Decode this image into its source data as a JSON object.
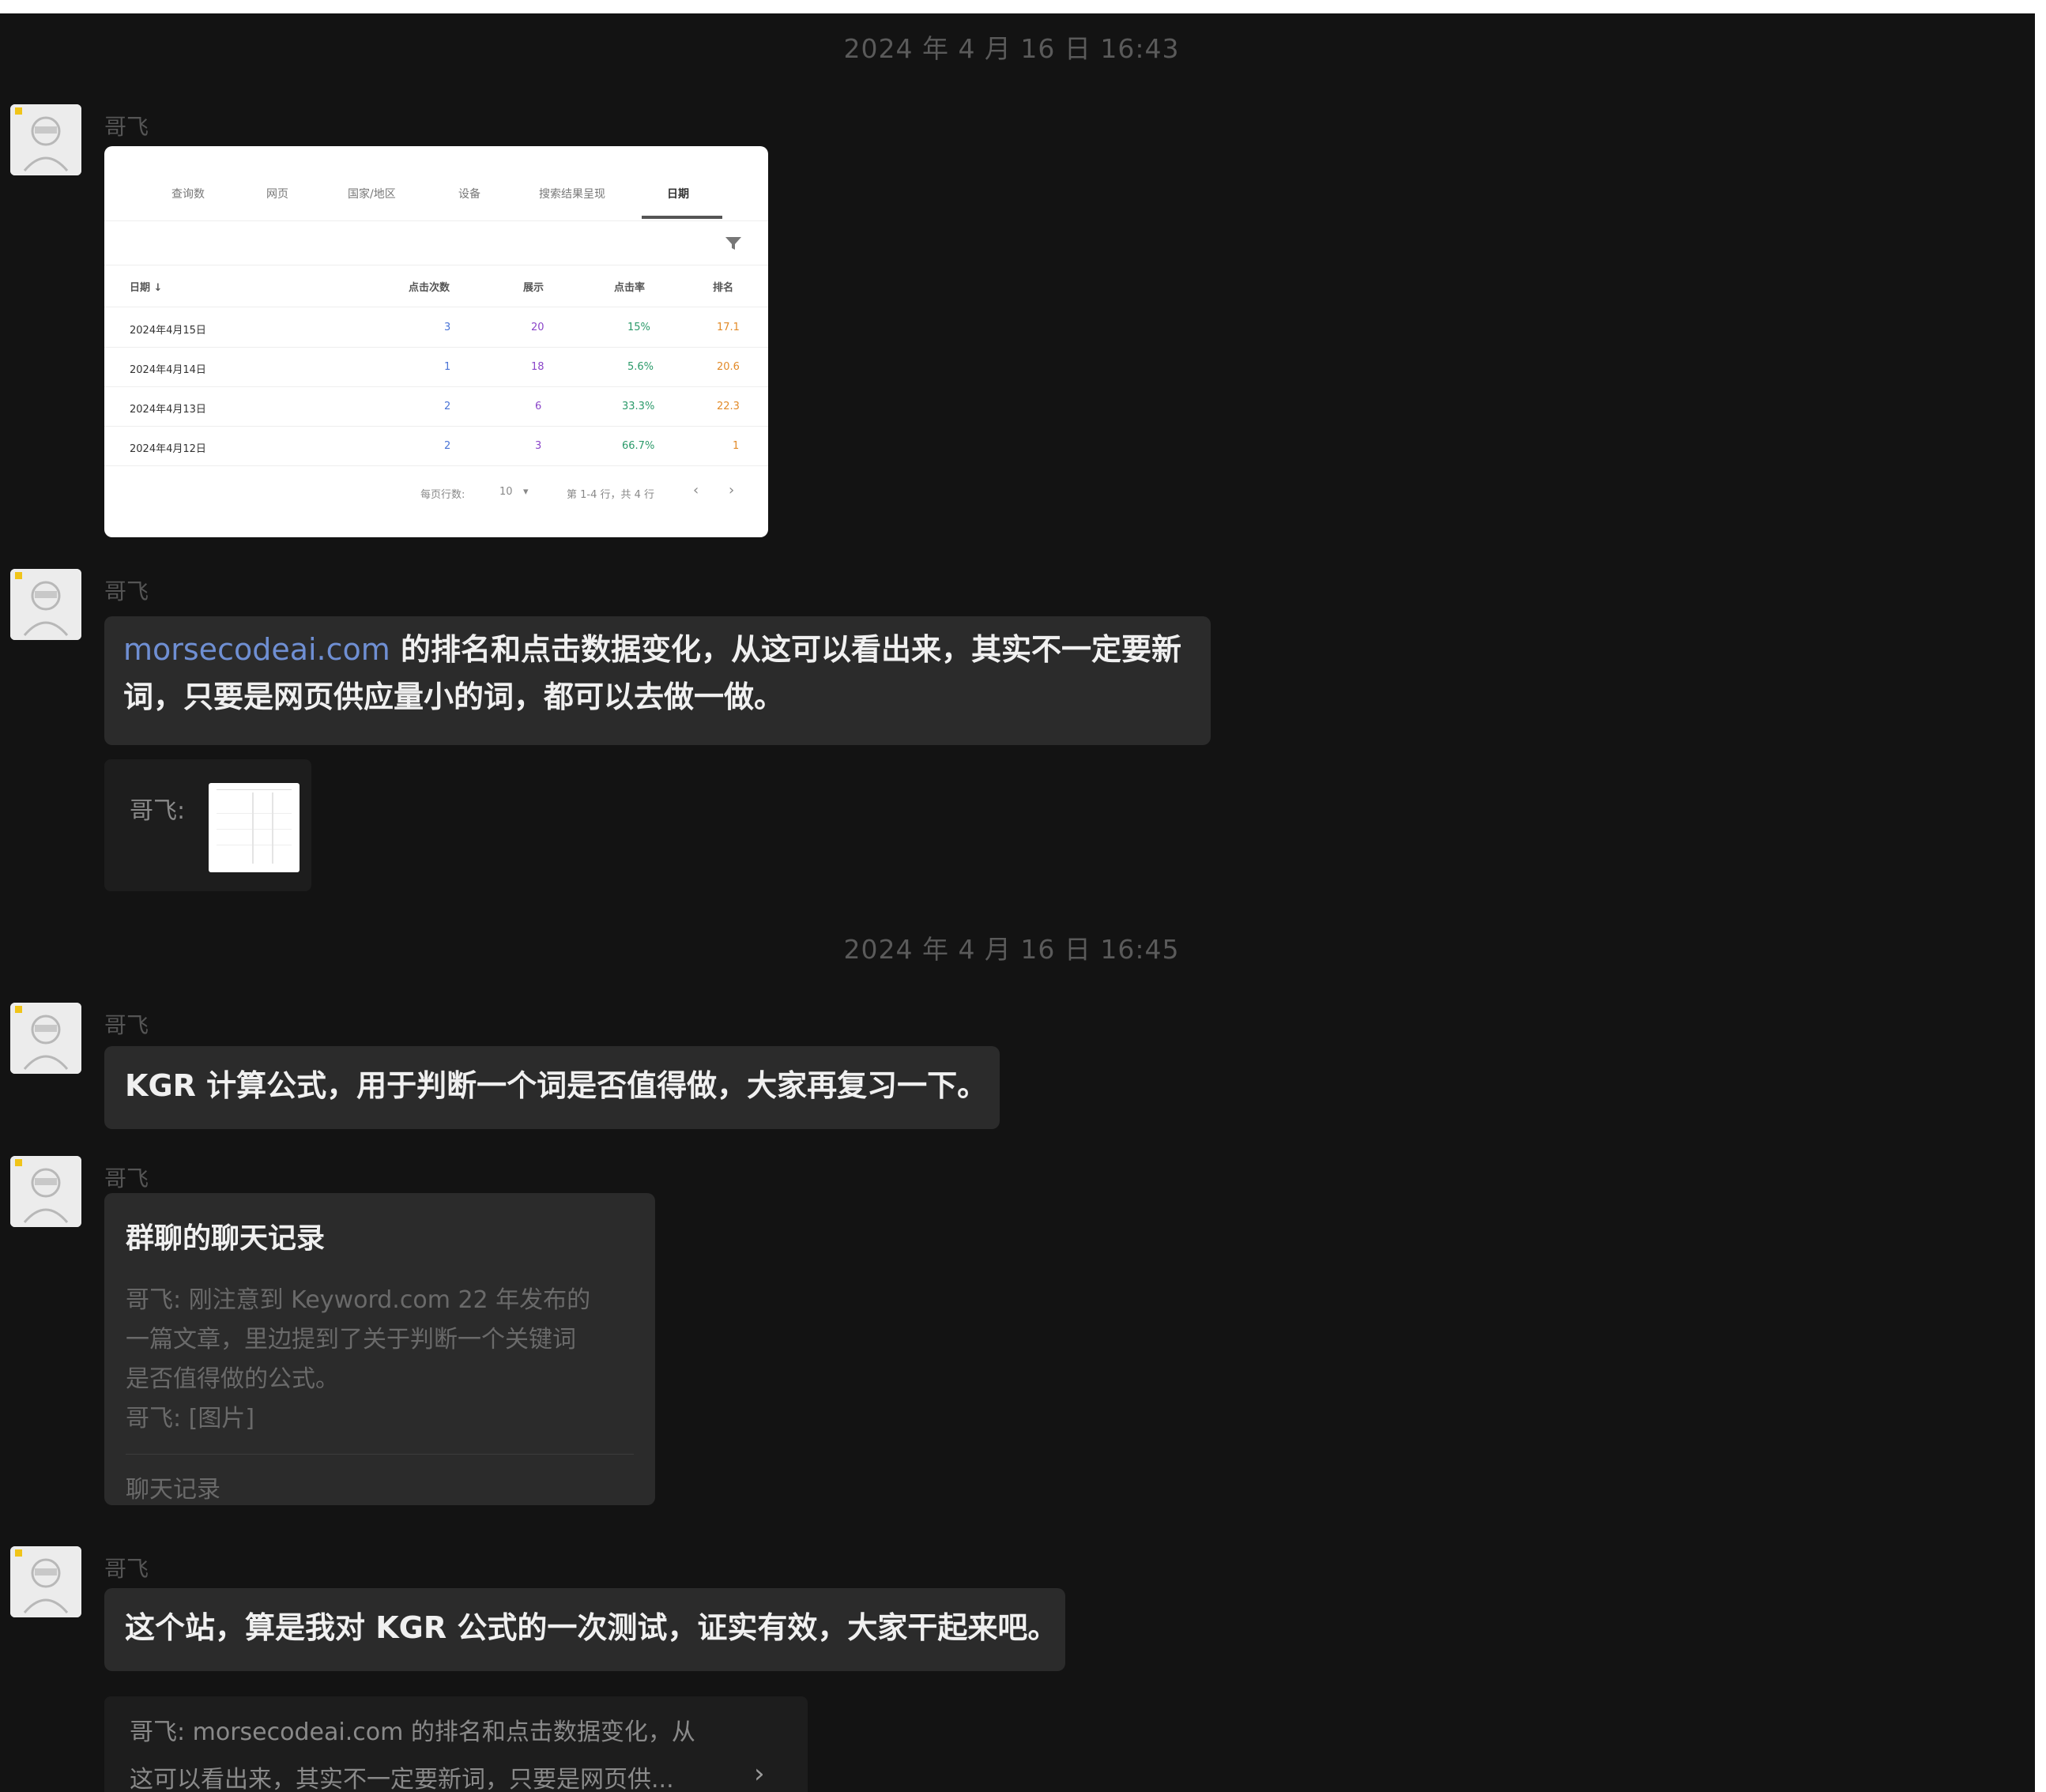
{
  "timestamps": [
    "2024 年 4 月 16 日 16:43",
    "2024 年 4 月 16 日 16:45"
  ],
  "sender_name": "哥飞",
  "embedded_screenshot": {
    "tabs": [
      "查询数",
      "网页",
      "国家/地区",
      "设备",
      "搜索结果呈现",
      "日期"
    ],
    "active_tab": "日期",
    "filter_icon": "filter-icon",
    "columns": [
      "日期 ↓",
      "点击次数",
      "展示",
      "点击率",
      "排名"
    ],
    "rows": [
      {
        "date": "2024年4月15日",
        "clicks": "3",
        "impressions": "20",
        "ctr": "15%",
        "position": "17.1"
      },
      {
        "date": "2024年4月14日",
        "clicks": "1",
        "impressions": "18",
        "ctr": "5.6%",
        "position": "20.6"
      },
      {
        "date": "2024年4月13日",
        "clicks": "2",
        "impressions": "6",
        "ctr": "33.3%",
        "position": "22.3"
      },
      {
        "date": "2024年4月12日",
        "clicks": "2",
        "impressions": "3",
        "ctr": "66.7%",
        "position": "1"
      }
    ],
    "footer": {
      "rows_label": "每页行数:",
      "rows_value": "10",
      "range_label": "第 1-4 行，共 4 行",
      "prev": "‹",
      "next": "›"
    }
  },
  "message2": {
    "link": "morsecodeai.com",
    "line1_rest": " 的排名和点击数据变化，从这可以看出来，其实不一定要新",
    "line2": "词，只要是网页供应量小的词，都可以去做一做。"
  },
  "quote1": {
    "name": "哥飞:"
  },
  "message3": "KGR 计算公式，用于判断一个词是否值得做，大家再复习一下。",
  "record_card": {
    "title": "群聊的聊天记录",
    "lines": [
      "哥飞: 刚注意到 Keyword.com 22 年发布的",
      "一篇文章，里边提到了关于判断一个关键词",
      "是否值得做的公式。",
      "哥飞: [图片]"
    ],
    "footer": "聊天记录"
  },
  "message5": "这个站，算是我对 KGR 公式的一次测试，证实有效，大家干起来吧。",
  "reply_quote": {
    "line1": "哥飞: morsecodeai.com 的排名和点击数据变化，从",
    "line2": "这可以看出来，其实不一定要新词，只要是网页供...",
    "arrow": "›"
  }
}
